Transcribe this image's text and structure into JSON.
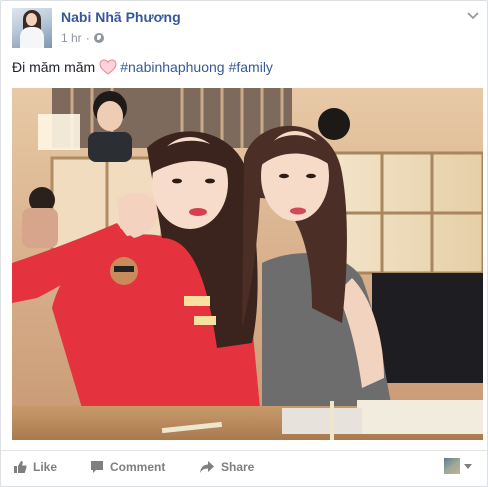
{
  "post": {
    "author_name": "Nabi Nhã Phương",
    "timestamp": "1 hr",
    "privacy_icon": "globe-icon",
    "menu_icon": "chevron-down-icon"
  },
  "caption": {
    "text": "Đi măm măm",
    "emoji": "heart-icon",
    "hashtags": [
      "#nabinhaphuong",
      "#family"
    ]
  },
  "photo": {
    "description_icon": "photo"
  },
  "actions": {
    "like": "Like",
    "comment": "Comment",
    "share": "Share"
  },
  "colors": {
    "link": "#365899",
    "meta": "#90949c",
    "action": "#7f7f7f",
    "heart": "#f4a6ae"
  }
}
